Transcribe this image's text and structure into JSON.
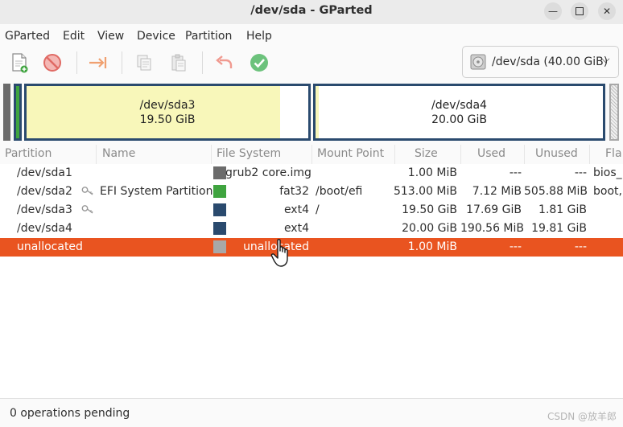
{
  "window": {
    "title": "/dev/sda - GParted"
  },
  "menubar": [
    "GParted",
    "Edit",
    "View",
    "Device",
    "Partition",
    "Help"
  ],
  "toolbar": {
    "buttons": [
      "new-icon",
      "delete-icon",
      "resize-move-icon",
      "copy-icon",
      "paste-icon",
      "undo-icon",
      "apply-icon"
    ],
    "device": "/dev/sda (40.00 GiB)"
  },
  "diskmap": {
    "sda3": {
      "name": "/dev/sda3",
      "size": "19.50 GiB",
      "used_fraction": 0.9
    },
    "sda4": {
      "name": "/dev/sda4",
      "size": "20.00 GiB",
      "used_fraction": 0.01
    }
  },
  "table": {
    "columns": [
      "Partition",
      "Name",
      "File System",
      "Mount Point",
      "Size",
      "Used",
      "Unused",
      "Fla"
    ],
    "rows": [
      {
        "partition": "/dev/sda1",
        "name": "",
        "fs": "grub2 core.img",
        "fs_color": "#6b6b6b",
        "mount": "",
        "size": "1.00 MiB",
        "used": "---",
        "unused": "---",
        "flags": "bios_",
        "key": false
      },
      {
        "partition": "/dev/sda2",
        "name": "EFI System Partition",
        "fs": "fat32",
        "fs_color": "#3fa43f",
        "mount": "/boot/efi",
        "size": "513.00 MiB",
        "used": "7.12 MiB",
        "unused": "505.88 MiB",
        "flags": "boot,",
        "key": true
      },
      {
        "partition": "/dev/sda3",
        "name": "",
        "fs": "ext4",
        "fs_color": "#2a4a6e",
        "mount": "/",
        "size": "19.50 GiB",
        "used": "17.69 GiB",
        "unused": "1.81 GiB",
        "flags": "",
        "key": true
      },
      {
        "partition": "/dev/sda4",
        "name": "",
        "fs": "ext4",
        "fs_color": "#2a4a6e",
        "mount": "",
        "size": "20.00 GiB",
        "used": "190.56 MiB",
        "unused": "19.81 GiB",
        "flags": "",
        "key": false
      },
      {
        "partition": "unallocated",
        "name": "",
        "fs": "unallocated",
        "fs_color": "#a8a8a8",
        "mount": "",
        "size": "1.00 MiB",
        "used": "---",
        "unused": "---",
        "flags": "",
        "key": false,
        "selected": true
      }
    ]
  },
  "status": {
    "text": "0 operations pending"
  },
  "watermark": "CSDN @放羊郎",
  "colors": {
    "selection": "#e95420",
    "ext4": "#2a4a6e",
    "fat32": "#3fa43f",
    "grub": "#6b6b6b",
    "used_fill": "#f8f7ba"
  }
}
